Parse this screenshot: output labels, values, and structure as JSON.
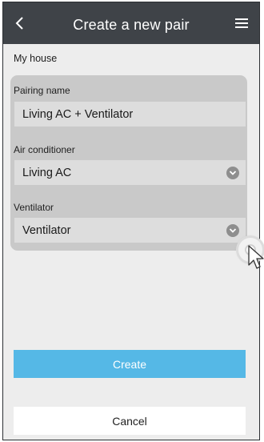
{
  "header": {
    "title": "Create a new pair",
    "back_icon": "chevron-left-icon",
    "menu_icon": "hamburger-menu-icon"
  },
  "location": {
    "label": "My house"
  },
  "form": {
    "pairing_name": {
      "label": "Pairing name",
      "value": "Living AC + Ventilator"
    },
    "air_conditioner": {
      "label": "Air conditioner",
      "value": "Living AC",
      "icon": "chevron-down-icon"
    },
    "ventilator": {
      "label": "Ventilator",
      "value": "Ventilator",
      "icon": "chevron-down-icon"
    }
  },
  "actions": {
    "create_label": "Create",
    "cancel_label": "Cancel"
  },
  "colors": {
    "header_bg": "#3f4348",
    "page_bg": "#ededed",
    "card_bg": "#c9c9c9",
    "field_bg": "#dddddd",
    "primary": "#55b8e6"
  }
}
